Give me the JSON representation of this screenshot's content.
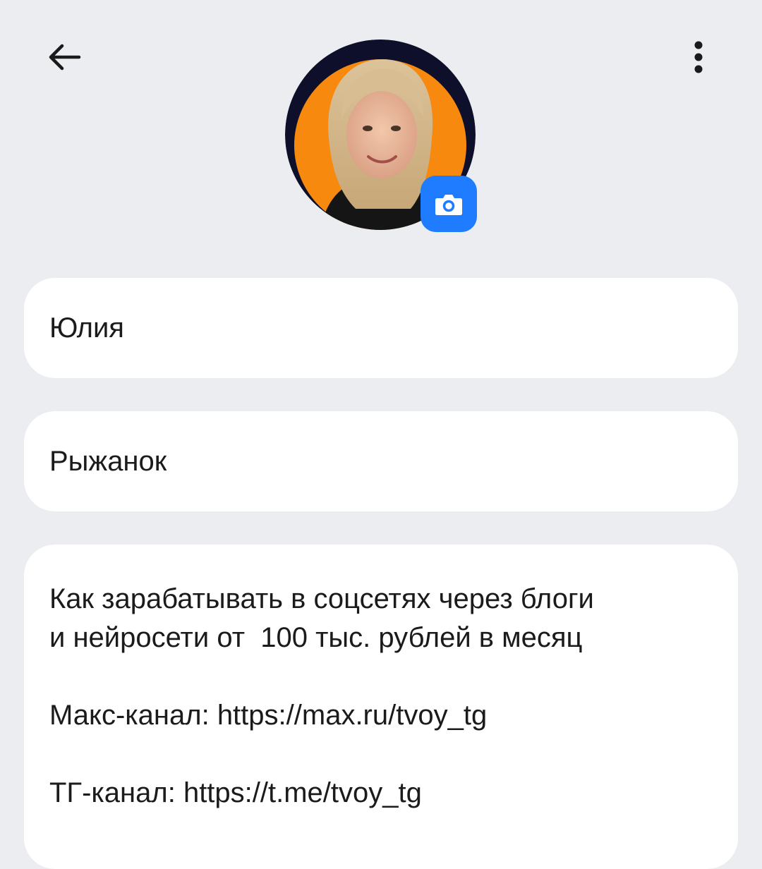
{
  "header": {
    "back_icon": "arrow-left-icon",
    "more_icon": "more-vertical-icon"
  },
  "profile": {
    "avatar_description": "photo-avatar",
    "camera_icon": "camera-icon",
    "first_name": "Юлия",
    "last_name": "Рыжанок",
    "about": {
      "line1": "Как зарабатывать в соцсетях через блоги",
      "line2": "и нейросети от  100 тыс. рублей в месяц",
      "max_channel": "Макс-канал: https://max.ru/tvoy_tg",
      "tg_channel": "ТГ-канал: https://t.me/tvoy_tg"
    }
  },
  "colors": {
    "background": "#ebedf1",
    "card": "#ffffff",
    "accent": "#1f7cff",
    "avatar_orange": "#f7890f",
    "avatar_dark": "#0e0f2a"
  }
}
